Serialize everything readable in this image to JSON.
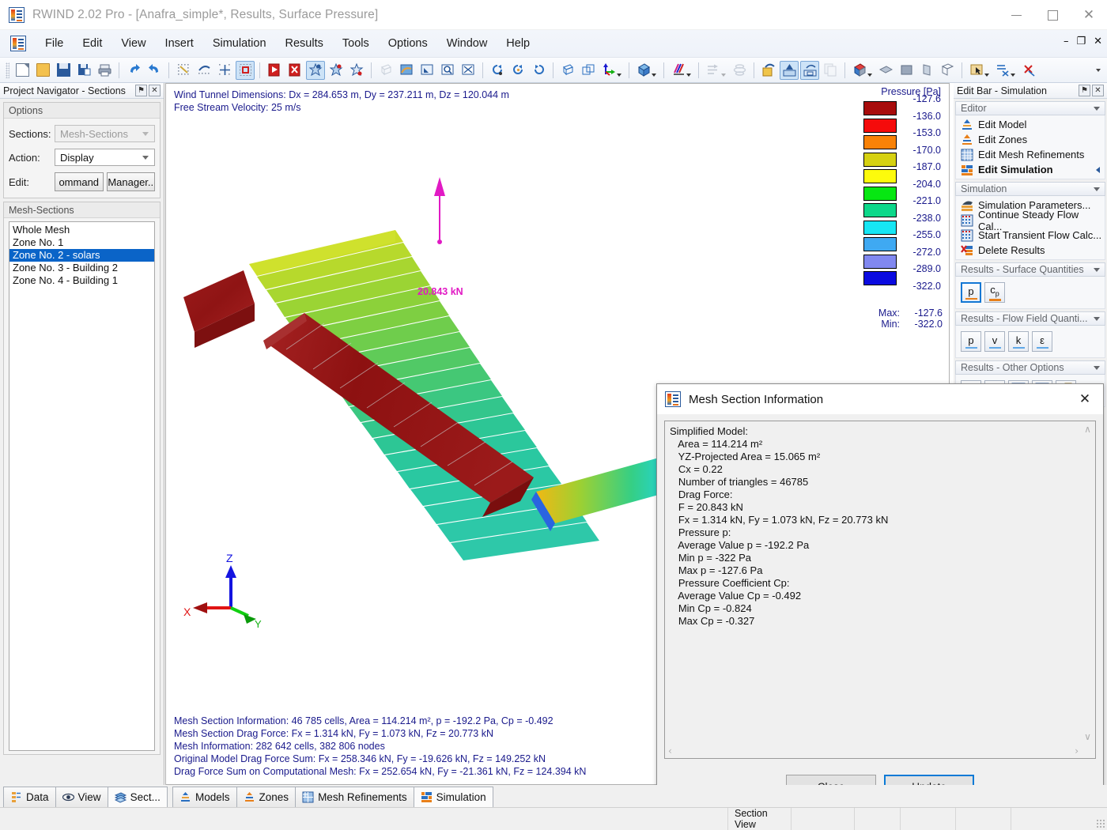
{
  "window": {
    "title": "RWIND 2.02 Pro - [Anafra_simple*, Results, Surface Pressure]",
    "minimize": "—",
    "maximize": "□",
    "close": "✕"
  },
  "mdi": {
    "minimize": "–",
    "restore": "❐",
    "close": "✕"
  },
  "menu": {
    "items": [
      "File",
      "Edit",
      "View",
      "Insert",
      "Simulation",
      "Results",
      "Tools",
      "Options",
      "Window",
      "Help"
    ]
  },
  "toolbar": {
    "buttons": [
      {
        "name": "new-file-icon",
        "kind": "doc"
      },
      {
        "name": "open-file-icon",
        "kind": "folder"
      },
      {
        "name": "save-icon",
        "kind": "save"
      },
      {
        "name": "save-as-icon",
        "kind": "saveas"
      },
      {
        "name": "print-icon",
        "kind": "print"
      },
      {
        "name": "separator",
        "kind": "sep"
      },
      {
        "name": "undo-icon",
        "kind": "undo"
      },
      {
        "name": "redo-icon",
        "kind": "redo"
      },
      {
        "name": "separator",
        "kind": "sep"
      },
      {
        "name": "point-snap-icon",
        "kind": "dots"
      },
      {
        "name": "object-snap-icon",
        "kind": "dots2"
      },
      {
        "name": "grid-snap-icon",
        "kind": "crosshair"
      },
      {
        "name": "selection-box-icon",
        "kind": "redbox",
        "active": true
      },
      {
        "name": "separator",
        "kind": "sep"
      },
      {
        "name": "show-model-icon",
        "kind": "redpanel"
      },
      {
        "name": "hide-model-icon",
        "kind": "redpanelx"
      },
      {
        "name": "render-surface-icon",
        "kind": "star",
        "active": true
      },
      {
        "name": "render-mesh-icon",
        "kind": "star2"
      },
      {
        "name": "render-wire-icon",
        "kind": "star3"
      },
      {
        "name": "separator",
        "kind": "sep"
      },
      {
        "name": "wireframe-view-icon",
        "kind": "cubewire",
        "disabled": true
      },
      {
        "name": "shaded-view-icon",
        "kind": "shaded"
      },
      {
        "name": "zoom-window-icon",
        "kind": "zoomwin"
      },
      {
        "name": "zoom-icon",
        "kind": "magnify"
      },
      {
        "name": "zoom-all-icon",
        "kind": "zoomall"
      },
      {
        "name": "separator",
        "kind": "sep"
      },
      {
        "name": "rotate-left-icon",
        "kind": "rot1"
      },
      {
        "name": "rotate-icon",
        "kind": "rot2"
      },
      {
        "name": "rotate-right-icon",
        "kind": "rot3"
      },
      {
        "name": "separator",
        "kind": "sep"
      },
      {
        "name": "isometric-view-icon",
        "kind": "iso"
      },
      {
        "name": "perspective-view-icon",
        "kind": "persp"
      },
      {
        "name": "axis-view-icon",
        "kind": "axis",
        "caret": true
      },
      {
        "name": "separator",
        "kind": "sep"
      },
      {
        "name": "view-cube-icon",
        "kind": "viewcube",
        "caret": true
      },
      {
        "name": "separator",
        "kind": "sep"
      },
      {
        "name": "colors-icon",
        "kind": "colors",
        "caret": true
      },
      {
        "name": "separator",
        "kind": "sep"
      },
      {
        "name": "flow-arrows-icon",
        "kind": "flowarrow",
        "caret": true,
        "disabled": true
      },
      {
        "name": "streamlines-icon",
        "kind": "stream",
        "disabled": true
      },
      {
        "name": "separator",
        "kind": "sep"
      },
      {
        "name": "results-panel-icon",
        "kind": "respanel"
      },
      {
        "name": "model-section-icon",
        "kind": "modsec",
        "active": true
      },
      {
        "name": "mesh-section-icon",
        "kind": "meshsec",
        "active": true
      },
      {
        "name": "clone-icon",
        "kind": "clone",
        "disabled": true
      },
      {
        "name": "separator",
        "kind": "sep"
      },
      {
        "name": "cutting-plane-icon",
        "kind": "cutplane",
        "caret": true
      },
      {
        "name": "plane-xy-icon",
        "kind": "planexy"
      },
      {
        "name": "plane-solid-icon",
        "kind": "planesolid"
      },
      {
        "name": "plane-yz-icon",
        "kind": "planeyz"
      },
      {
        "name": "plane-xz-icon",
        "kind": "planexz"
      },
      {
        "name": "separator",
        "kind": "sep"
      },
      {
        "name": "pick-tool-icon",
        "kind": "pick",
        "caret": true
      },
      {
        "name": "section-tool-icon",
        "kind": "sectiontool",
        "caret": true
      },
      {
        "name": "delete-section-icon",
        "kind": "delsec"
      }
    ]
  },
  "left_panel": {
    "caption": "Project Navigator - Sections",
    "pin_glyph": "⚑",
    "close_glyph": "✕",
    "options_group": "Options",
    "fields": {
      "sections_label": "Sections:",
      "sections_value": "Mesh-Sections",
      "action_label": "Action:",
      "action_value": "Display",
      "edit_label": "Edit:",
      "edit_button_1": "ommand",
      "edit_button_2": "Manager.."
    },
    "list_group": "Mesh-Sections",
    "list_items": [
      {
        "label": "Whole Mesh",
        "selected": false
      },
      {
        "label": "Zone No. 1",
        "selected": false
      },
      {
        "label": "Zone No. 2 - solars",
        "selected": true
      },
      {
        "label": "Zone No. 3 - Building 2",
        "selected": false
      },
      {
        "label": "Zone No. 4 - Building 1",
        "selected": false
      }
    ]
  },
  "viewport": {
    "header_lines": [
      "Wind Tunnel Dimensions: Dx = 284.653 m, Dy = 237.211 m, Dz = 120.044 m",
      "Free Stream Velocity: 25 m/s"
    ],
    "footer_lines": [
      "Mesh Section Information: 46 785 cells, Area = 114.214 m², p = -192.2 Pa, Cp = -0.492",
      "Mesh Section Drag Force: Fx = 1.314 kN, Fy = 1.073 kN, Fz = 20.773 kN",
      "Mesh Information: 282 642 cells, 382 806 nodes",
      "Original Model Drag Force Sum: Fx = 258.346 kN, Fy = -19.626 kN, Fz = 149.252 kN",
      "Drag Force Sum on Computational Mesh: Fx = 252.654 kN, Fy = -21.361 kN, Fz = 124.394 kN"
    ],
    "force_label": "20.843 kN",
    "force_color": "#e11ac4",
    "axes": {
      "x": "X",
      "y": "Y",
      "z": "Z"
    }
  },
  "chart_data": {
    "type": "heatmap",
    "title": "Pressure [Pa]",
    "unit": "Pa",
    "colorbar_levels": [
      -127.6,
      -136.0,
      -153.0,
      -170.0,
      -187.0,
      -204.0,
      -221.0,
      -238.0,
      -255.0,
      -272.0,
      -289.0,
      -322.0
    ],
    "colorbar_colors": [
      "#a80c0c",
      "#f50b0b",
      "#f98207",
      "#d6d111",
      "#fdfb0c",
      "#07e712",
      "#0dd88a",
      "#16e6f4",
      "#3fa9f2",
      "#8188f0",
      "#0a0ae0"
    ],
    "max_label": "Max:",
    "max_value": "-127.6",
    "min_label": "Min:",
    "min_value": "-322.0"
  },
  "edit_bar": {
    "caption": "Edit Bar - Simulation",
    "pin_glyph": "⚑",
    "close_glyph": "✕",
    "groups": [
      {
        "title": "Editor",
        "items": [
          {
            "label": "Edit Model",
            "icon": "model-icon",
            "bold": false
          },
          {
            "label": "Edit Zones",
            "icon": "zones-icon",
            "bold": false
          },
          {
            "label": "Edit Mesh Refinements",
            "icon": "mesh-icon",
            "bold": false
          },
          {
            "label": "Edit Simulation",
            "icon": "simulation-icon",
            "bold": true,
            "marker": true
          }
        ]
      },
      {
        "title": "Simulation",
        "items": [
          {
            "label": "Simulation Parameters...",
            "icon": "parameters-icon",
            "bold": false
          },
          {
            "label": "Continue Steady Flow Cal...",
            "icon": "steady-flow-icon",
            "bold": false
          },
          {
            "label": "Start Transient Flow Calc...",
            "icon": "transient-flow-icon",
            "bold": false
          },
          {
            "label": "Delete Results",
            "icon": "delete-results-icon",
            "bold": false
          }
        ]
      }
    ],
    "surface_quantities": {
      "title": "Results - Surface Quantities",
      "buttons": [
        {
          "label": "p",
          "sub": "",
          "selected": true,
          "underline": "orange"
        },
        {
          "label": "c",
          "sub": "p",
          "selected": false,
          "underline": "orange"
        }
      ]
    },
    "flow_field": {
      "title": "Results - Flow Field Quanti...",
      "buttons": [
        {
          "label": "p",
          "sub": "",
          "selected": false,
          "underline": "blue"
        },
        {
          "label": "v",
          "sub": "",
          "selected": false,
          "underline": "blue"
        },
        {
          "label": "k",
          "sub": "",
          "selected": false,
          "underline": "blue"
        },
        {
          "label": "ε",
          "sub": "",
          "selected": false,
          "underline": "blue"
        }
      ]
    },
    "other_options": {
      "title": "Results - Other Options",
      "buttons": [
        {
          "name": "flow-arrows-option-icon"
        },
        {
          "name": "streamlines-option-icon"
        },
        {
          "name": "convergence-graph-icon"
        },
        {
          "name": "result-diagram-icon"
        },
        {
          "name": "info-tool-icon"
        }
      ]
    }
  },
  "dialog": {
    "title": "Mesh Section Information",
    "close_glyph": "✕",
    "body_lines": [
      "Simplified Model:",
      "   Area = 114.214 m²",
      "   YZ-Projected Area = 15.065 m²",
      "   Cx = 0.22",
      "   Number of triangles = 46785",
      "   Drag Force:",
      "   F = 20.843 kN",
      "   Fx = 1.314 kN, Fy = 1.073 kN, Fz = 20.773 kN",
      "   Pressure p:",
      "   Average Value p = -192.2 Pa",
      "   Min p = -322 Pa",
      "   Max p = -127.6 Pa",
      "   Pressure Coefficient Cp:",
      "   Average Value Cp = -0.492",
      "   Min Cp = -0.824",
      "   Max Cp = -0.327"
    ],
    "scroll_up": "∧",
    "scroll_down": "∨",
    "scroll_left": "‹",
    "scroll_right": "›",
    "close_button": "Close",
    "update_button": "Update"
  },
  "bottom_tabs": {
    "navigator_tabs": [
      {
        "label": "Data",
        "icon": "data-icon",
        "active": false
      },
      {
        "label": "View",
        "icon": "view-eye-icon",
        "active": false
      },
      {
        "label": "Sect...",
        "icon": "sections-icon",
        "active": true
      }
    ],
    "workflow_tabs": [
      {
        "label": "Models",
        "icon": "models-icon",
        "active": false
      },
      {
        "label": "Zones",
        "icon": "zones-tab-icon",
        "active": false
      },
      {
        "label": "Mesh Refinements",
        "icon": "mesh-refinements-icon",
        "active": false
      },
      {
        "label": "Simulation",
        "icon": "simulation-tab-icon",
        "active": true
      }
    ]
  },
  "status_bar": {
    "cells": [
      "Section View",
      "",
      "",
      "",
      "",
      ""
    ]
  }
}
